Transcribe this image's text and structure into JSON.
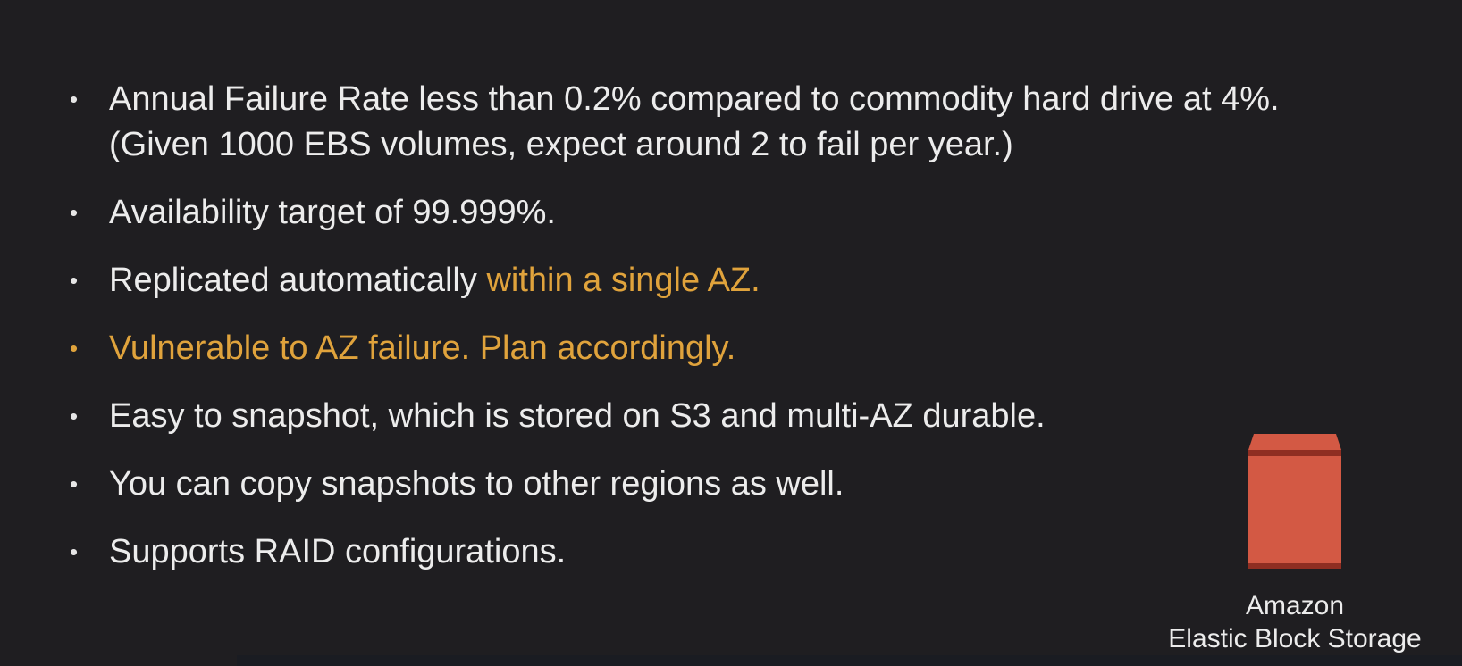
{
  "bullets": [
    {
      "text": "Annual Failure Rate less than 0.2% compared to commodity hard drive at 4%.  (Given 1000 EBS volumes, expect around 2 to fail per year.)",
      "highlight": ""
    },
    {
      "text": "Availability target of 99.999%.",
      "highlight": ""
    },
    {
      "text": "Replicated automatically ",
      "highlight": "within a single AZ."
    },
    {
      "text": "Vulnerable to AZ failure.  Plan accordingly.",
      "highlight": ""
    },
    {
      "text": "Easy to snapshot, which is stored on S3 and multi-AZ durable.",
      "highlight": ""
    },
    {
      "text": "You can copy snapshots to other regions as well.",
      "highlight": ""
    },
    {
      "text": "Supports RAID configurations.",
      "highlight": ""
    }
  ],
  "bullet_glyph": "•",
  "ebs": {
    "icon": "ebs-volume-icon",
    "caption_line1": "Amazon",
    "caption_line2": "Elastic Block Storage"
  },
  "colors": {
    "background": "#1f1e21",
    "text": "#ececec",
    "highlight": "#e0a33c",
    "icon_body": "#d35944",
    "icon_dark": "#8f2e22"
  }
}
